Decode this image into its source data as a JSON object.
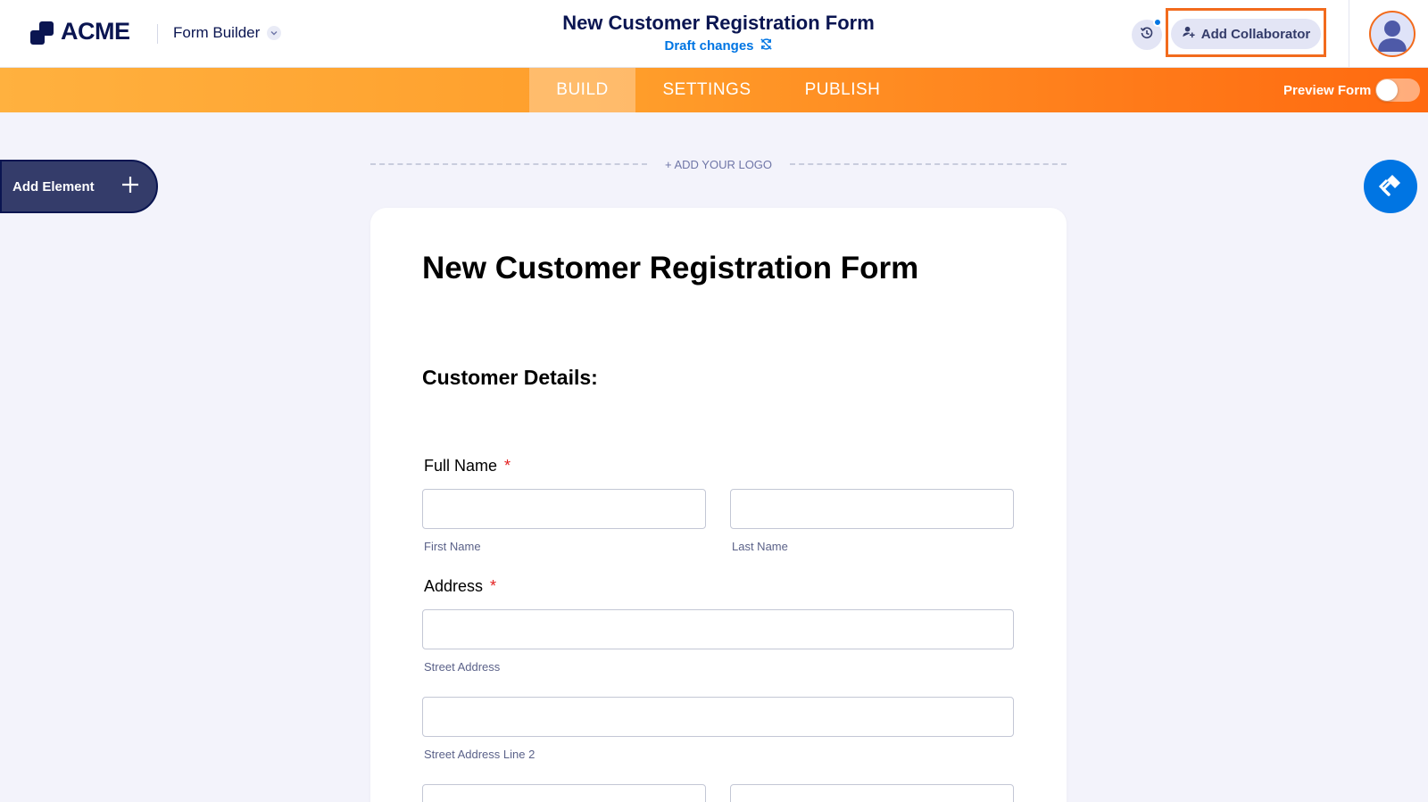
{
  "header": {
    "logo_text": "ACME",
    "app_switch_label": "Form Builder",
    "form_title": "New Customer Registration Form",
    "draft_status": "Draft changes",
    "add_collaborator_label": "Add Collaborator"
  },
  "nav": {
    "tabs": [
      {
        "label": "BUILD",
        "active": true
      },
      {
        "label": "SETTINGS",
        "active": false
      },
      {
        "label": "PUBLISH",
        "active": false
      }
    ],
    "preview_label": "Preview Form",
    "preview_enabled": false
  },
  "canvas": {
    "add_element_label": "Add Element",
    "add_logo_label": "+ ADD YOUR LOGO"
  },
  "form": {
    "title": "New Customer Registration Form",
    "section_title": "Customer Details:",
    "full_name": {
      "label": "Full Name",
      "required_mark": "*",
      "first_sublabel": "First Name",
      "last_sublabel": "Last Name"
    },
    "address": {
      "label": "Address",
      "required_mark": "*",
      "street_sublabel": "Street Address",
      "street2_sublabel": "Street Address Line 2"
    }
  },
  "colors": {
    "brand_navy": "#0a1551",
    "accent_orange": "#ff7a19",
    "link_blue": "#0075e3",
    "required_red": "#e32020"
  },
  "icons": [
    "history-icon",
    "add-user-icon",
    "user-icon",
    "chevron-down-icon",
    "sync-icon",
    "plus-icon",
    "paint-roller-icon"
  ]
}
